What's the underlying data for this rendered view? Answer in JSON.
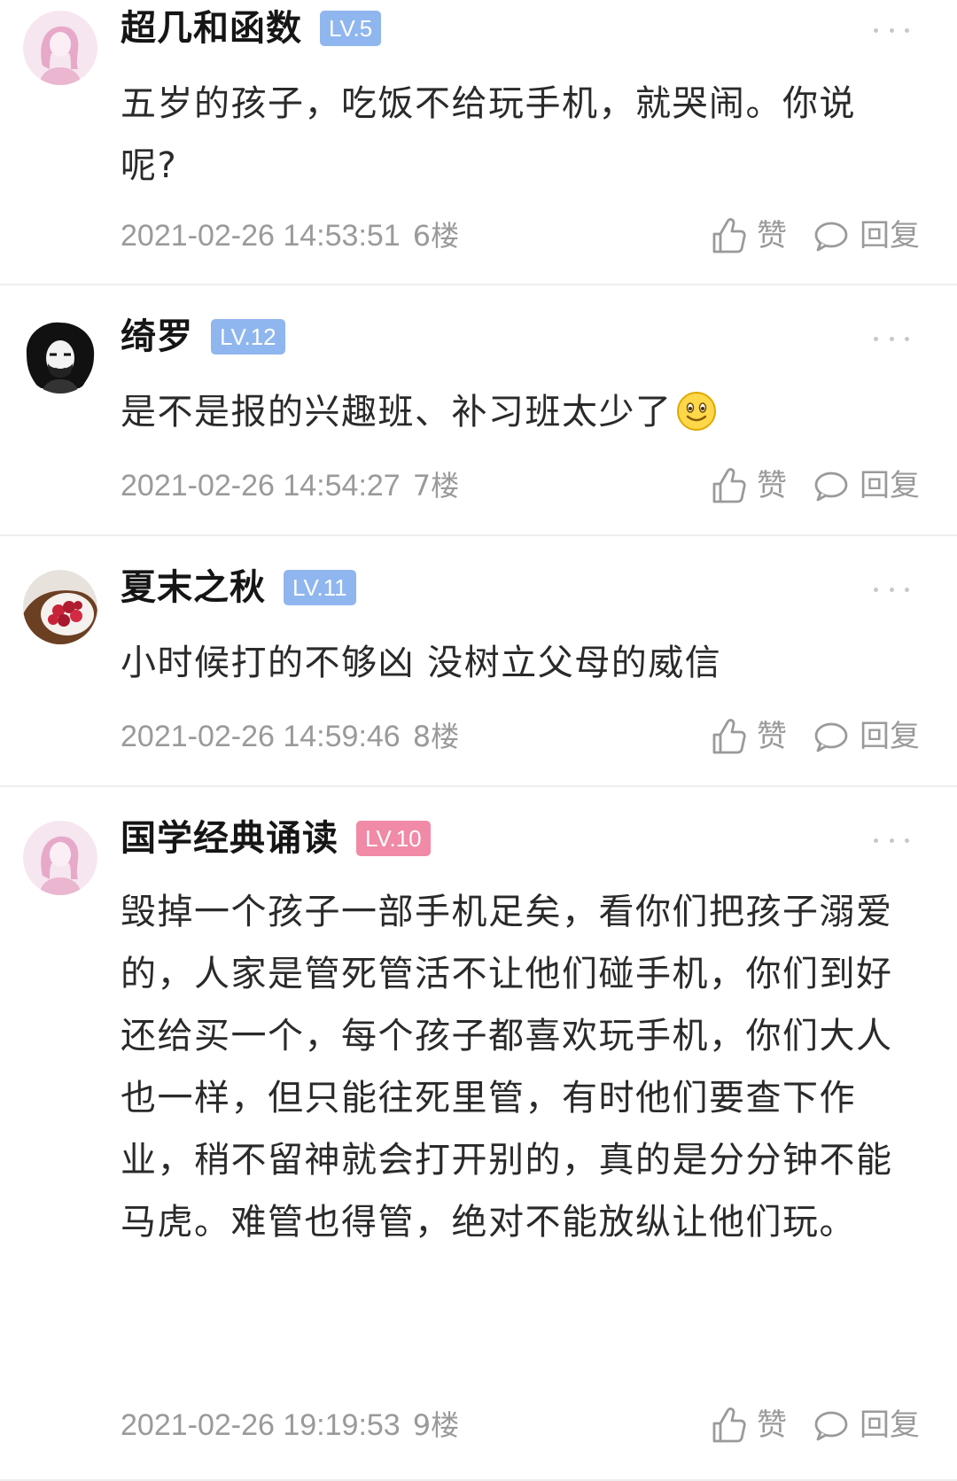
{
  "comments": [
    {
      "username": "超几和函数",
      "level": "LV.5",
      "level_color": "#8fb6ee",
      "avatar": "pink-female-avatar",
      "text": "五岁的孩子，吃饭不给玩手机，就哭闹。你说呢?",
      "datetime": "2021-02-26 14:53:51",
      "floor": "6楼",
      "like_label": "赞",
      "reply_label": "回复"
    },
    {
      "username": "绮罗",
      "level": "LV.12",
      "level_color": "#8fb6ee",
      "avatar": "bw-portrait-avatar",
      "text": "是不是报的兴趣班、补习班太少了",
      "emoji": "smile-emoji",
      "datetime": "2021-02-26 14:54:27",
      "floor": "7楼",
      "like_label": "赞",
      "reply_label": "回复"
    },
    {
      "username": "夏末之秋",
      "level": "LV.11",
      "level_color": "#8fb6ee",
      "avatar": "berries-photo-avatar",
      "text": "小时候打的不够凶 没树立父母的威信",
      "datetime": "2021-02-26 14:59:46",
      "floor": "8楼",
      "like_label": "赞",
      "reply_label": "回复"
    },
    {
      "username": "国学经典诵读",
      "level": "LV.10",
      "level_color": "#f08aa6",
      "avatar": "pink-female-avatar",
      "text": "毁掉一个孩子一部手机足矣，看你们把孩子溺爱的，人家是管死管活不让他们碰手机，你们到好还给买一个，每个孩子都喜欢玩手机，你们大人也一样，但只能往死里管，有时他们要查下作业，稍不留神就会打开别的，真的是分分钟不能马虎。难管也得管，绝对不能放纵让他们玩。",
      "datetime": "2021-02-26 19:19:53",
      "floor": "9楼",
      "like_label": "赞",
      "reply_label": "回复"
    }
  ]
}
